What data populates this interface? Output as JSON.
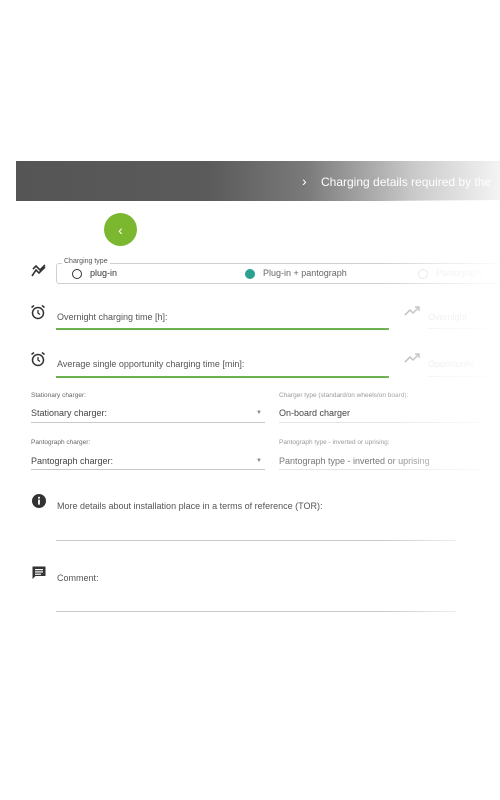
{
  "header": {
    "title": "Charging details required by the"
  },
  "charging_type": {
    "legend": "Charging type",
    "options": [
      {
        "label": "plug-in",
        "selected": false
      },
      {
        "label": "Plug-in + pantograph",
        "selected": true
      },
      {
        "label": "Pantograph",
        "selected": false
      }
    ]
  },
  "overnight": {
    "label": "Overnight charging time [h]:",
    "right_label": "Overnight"
  },
  "opportunity": {
    "label": "Average single opportunity charging time [min]:",
    "right_label": "Opportunity"
  },
  "stationary_charger": {
    "label": "Stationary charger:",
    "value": "Stationary charger:"
  },
  "charger_type": {
    "label": "Charger type (standard/on wheels/on board):",
    "value": "On-board charger"
  },
  "pantograph_charger": {
    "label": "Pantograph charger:",
    "value": "Pantograph charger:"
  },
  "pantograph_type": {
    "label": "Pantograph type - inverted or uprising:",
    "value": "Pantograph type - inverted or uprising"
  },
  "tor": {
    "label": "More details about installation place in a terms of reference (TOR):"
  },
  "comment": {
    "label": "Comment:"
  },
  "colors": {
    "accent": "#7cb82f",
    "radio_selected": "#2aa28e",
    "active_underline": "#6ab04c",
    "header_dark": "#555555"
  }
}
